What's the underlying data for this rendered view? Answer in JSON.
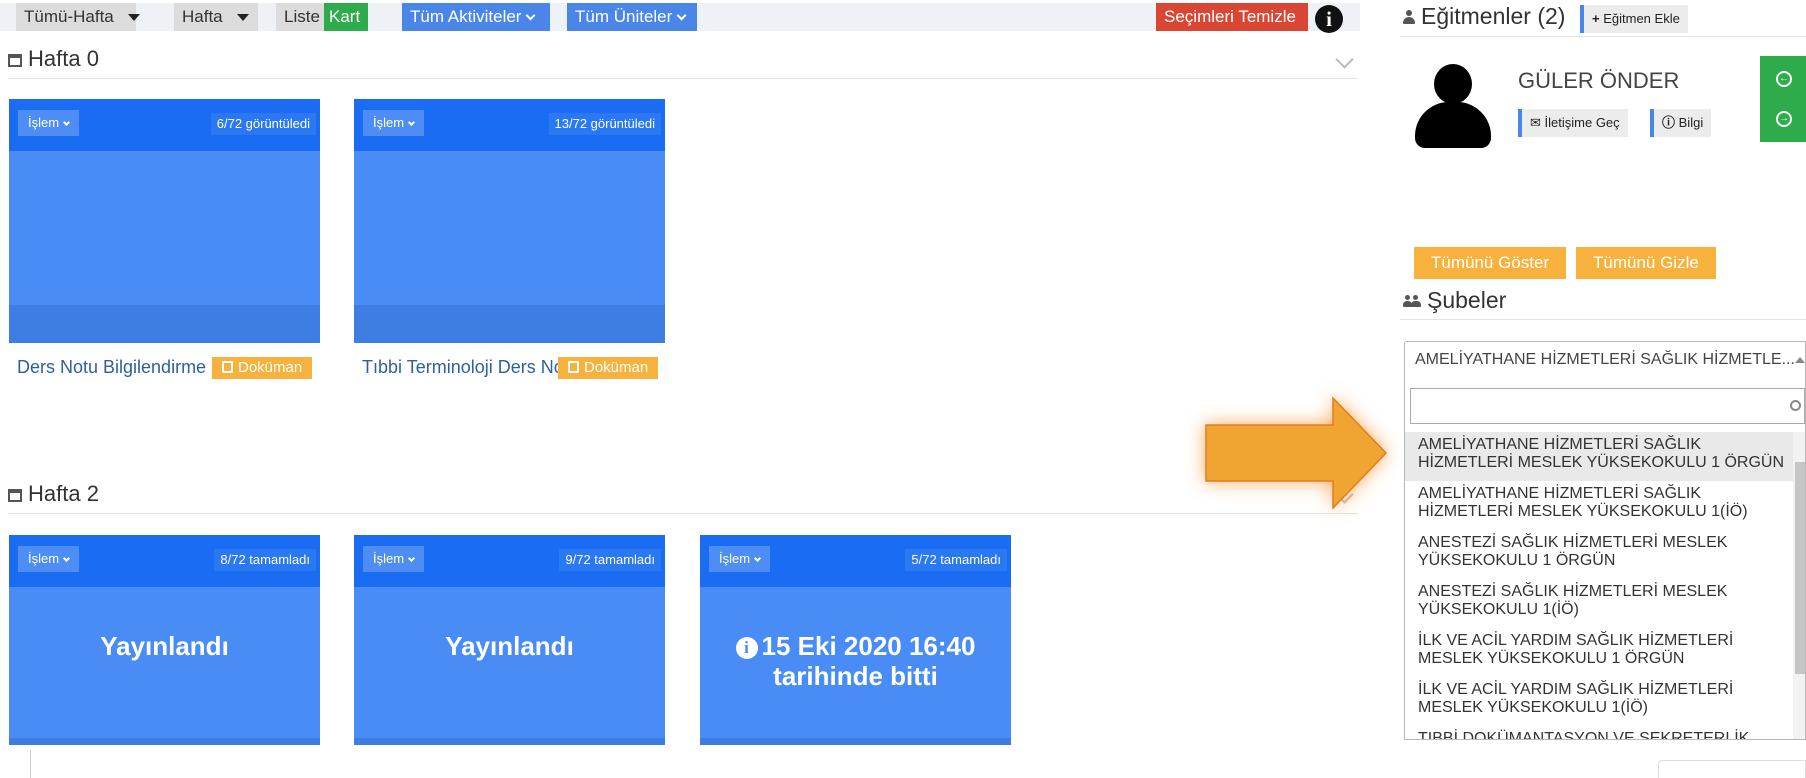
{
  "toolbar": {
    "week_filter": "Tümü-Hafta",
    "week_unit": "Hafta",
    "view_list": "Liste",
    "view_card": "Kart",
    "activities": "Tüm Aktiviteler",
    "units": "Tüm Üniteler",
    "clear": "Seçimleri Temizle"
  },
  "weeks": [
    {
      "title": "Hafta 0",
      "cards": [
        {
          "menu": "İşlem",
          "stat": "6/72 görüntüledi",
          "title": "Ders Notu Bilgilendirme",
          "badge": "Doküman"
        },
        {
          "menu": "İşlem",
          "stat": "13/72 görüntüledi",
          "title": "Tıbbi Terminoloji Ders Notu",
          "badge": "Doküman"
        }
      ]
    },
    {
      "title": "Hafta 2",
      "cards": [
        {
          "menu": "İşlem",
          "stat": "8/72 tamamladı",
          "status": "Yayınlandı"
        },
        {
          "menu": "İşlem",
          "stat": "9/72 tamamladı",
          "status": "Yayınlandı"
        },
        {
          "menu": "İşlem",
          "stat": "5/72 tamamladı",
          "status_line1": "15 Eki 2020 16:40",
          "status_line2": "tarihinde bitti"
        }
      ]
    }
  ],
  "instructors": {
    "title": "Eğitmenler (2)",
    "add_label": "Eğitmen Ekle",
    "name": "GÜLER ÖNDER",
    "contact_label": "İletişime Geç",
    "info_label": "Bilgi"
  },
  "branches": {
    "show_all": "Tümünü Göster",
    "hide_all": "Tümünü Gizle",
    "title": "Şubeler",
    "selected": "AMELİYATHANE HİZMETLERİ SAĞLIK HİZMETLE...",
    "search_value": "",
    "options": [
      {
        "line1": "AMELİYATHANE HİZMETLERİ SAĞLIK",
        "line2": "HİZMETLERİ MESLEK YÜKSEKOKULU 1 ÖRGÜN"
      },
      {
        "line1": "AMELİYATHANE HİZMETLERİ SAĞLIK",
        "line2": "HİZMETLERİ MESLEK YÜKSEKOKULU 1(İÖ)"
      },
      {
        "line1": "ANESTEZİ SAĞLIK HİZMETLERİ MESLEK",
        "line2": "YÜKSEKOKULU 1 ÖRGÜN"
      },
      {
        "line1": "ANESTEZİ SAĞLIK HİZMETLERİ MESLEK",
        "line2": "YÜKSEKOKULU 1(İÖ)"
      },
      {
        "line1": "İLK VE ACİL YARDIM SAĞLIK HİZMETLERİ",
        "line2": "MESLEK YÜKSEKOKULU 1 ÖRGÜN"
      },
      {
        "line1": "İLK VE ACİL YARDIM SAĞLIK HİZMETLERİ",
        "line2": "MESLEK YÜKSEKOKULU 1(İÖ)"
      },
      {
        "line1": "TIBBİ DOKÜMANTASYON VE SEKRETERLİK",
        "line2": ""
      }
    ]
  },
  "colors": {
    "card_blue": "#4a8cf5",
    "card_header": "#1a6cf2",
    "accent_blue": "#4a86e8",
    "green": "#2eab4a",
    "red": "#d94734",
    "orange": "#f6b23d",
    "arrow_orange": "#f0a532"
  },
  "icons": [
    "calendar-icon",
    "user-icon",
    "users-icon",
    "plus-icon",
    "envelope-icon",
    "info-icon",
    "book-icon",
    "search-icon",
    "sign-in-icon",
    "sign-out-icon"
  ]
}
